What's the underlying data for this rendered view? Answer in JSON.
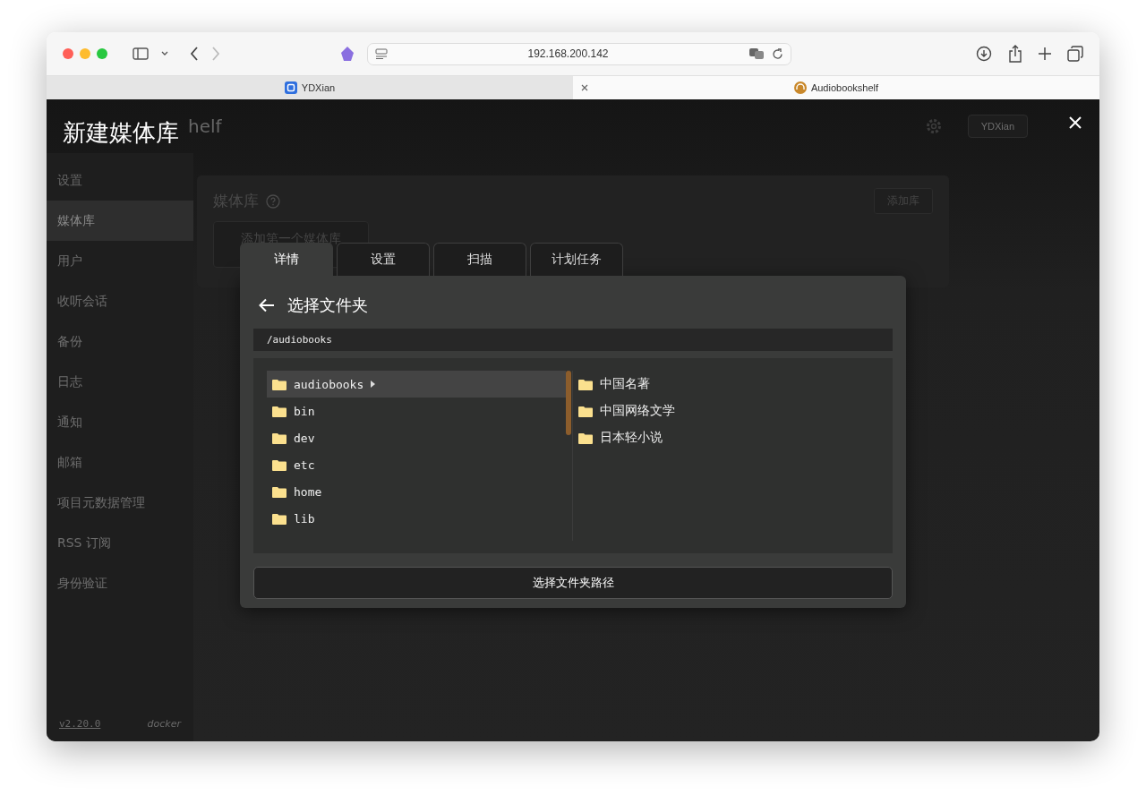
{
  "browser": {
    "url": "192.168.200.142",
    "tabs": [
      {
        "title": "YDXian",
        "selected": false
      },
      {
        "title": "Audiobookshelf",
        "selected": true
      }
    ]
  },
  "app": {
    "title_fragment": "helf",
    "user_button": "YDXian",
    "sidebar": {
      "heading": "设置",
      "items": [
        {
          "label": "媒体库",
          "selected": true
        },
        {
          "label": "用户",
          "selected": false
        },
        {
          "label": "收听会话",
          "selected": false
        },
        {
          "label": "备份",
          "selected": false
        },
        {
          "label": "日志",
          "selected": false
        },
        {
          "label": "通知",
          "selected": false
        },
        {
          "label": "邮箱",
          "selected": false
        },
        {
          "label": "项目元数据管理",
          "selected": false
        },
        {
          "label": "RSS 订阅",
          "selected": false
        },
        {
          "label": "身份验证",
          "selected": false
        }
      ],
      "version": "v2.20.0",
      "build": "docker"
    },
    "section": {
      "title": "媒体库",
      "add_button": "添加库",
      "empty_button": "添加第一个媒体库"
    }
  },
  "modal": {
    "title": "新建媒体库",
    "tabs": [
      {
        "label": "详情",
        "selected": true
      },
      {
        "label": "设置",
        "selected": false
      },
      {
        "label": "扫描",
        "selected": false
      },
      {
        "label": "计划任务",
        "selected": false
      }
    ],
    "panel": {
      "title": "选择文件夹",
      "path": "/audiobooks",
      "folders": [
        {
          "name": "audiobooks",
          "selected": true
        },
        {
          "name": "bin",
          "selected": false
        },
        {
          "name": "dev",
          "selected": false
        },
        {
          "name": "etc",
          "selected": false
        },
        {
          "name": "home",
          "selected": false
        },
        {
          "name": "lib",
          "selected": false
        }
      ],
      "subfolders": [
        {
          "name": "中国名著"
        },
        {
          "name": "中国网络文学"
        },
        {
          "name": "日本轻小说"
        }
      ],
      "button": "选择文件夹路径"
    }
  }
}
